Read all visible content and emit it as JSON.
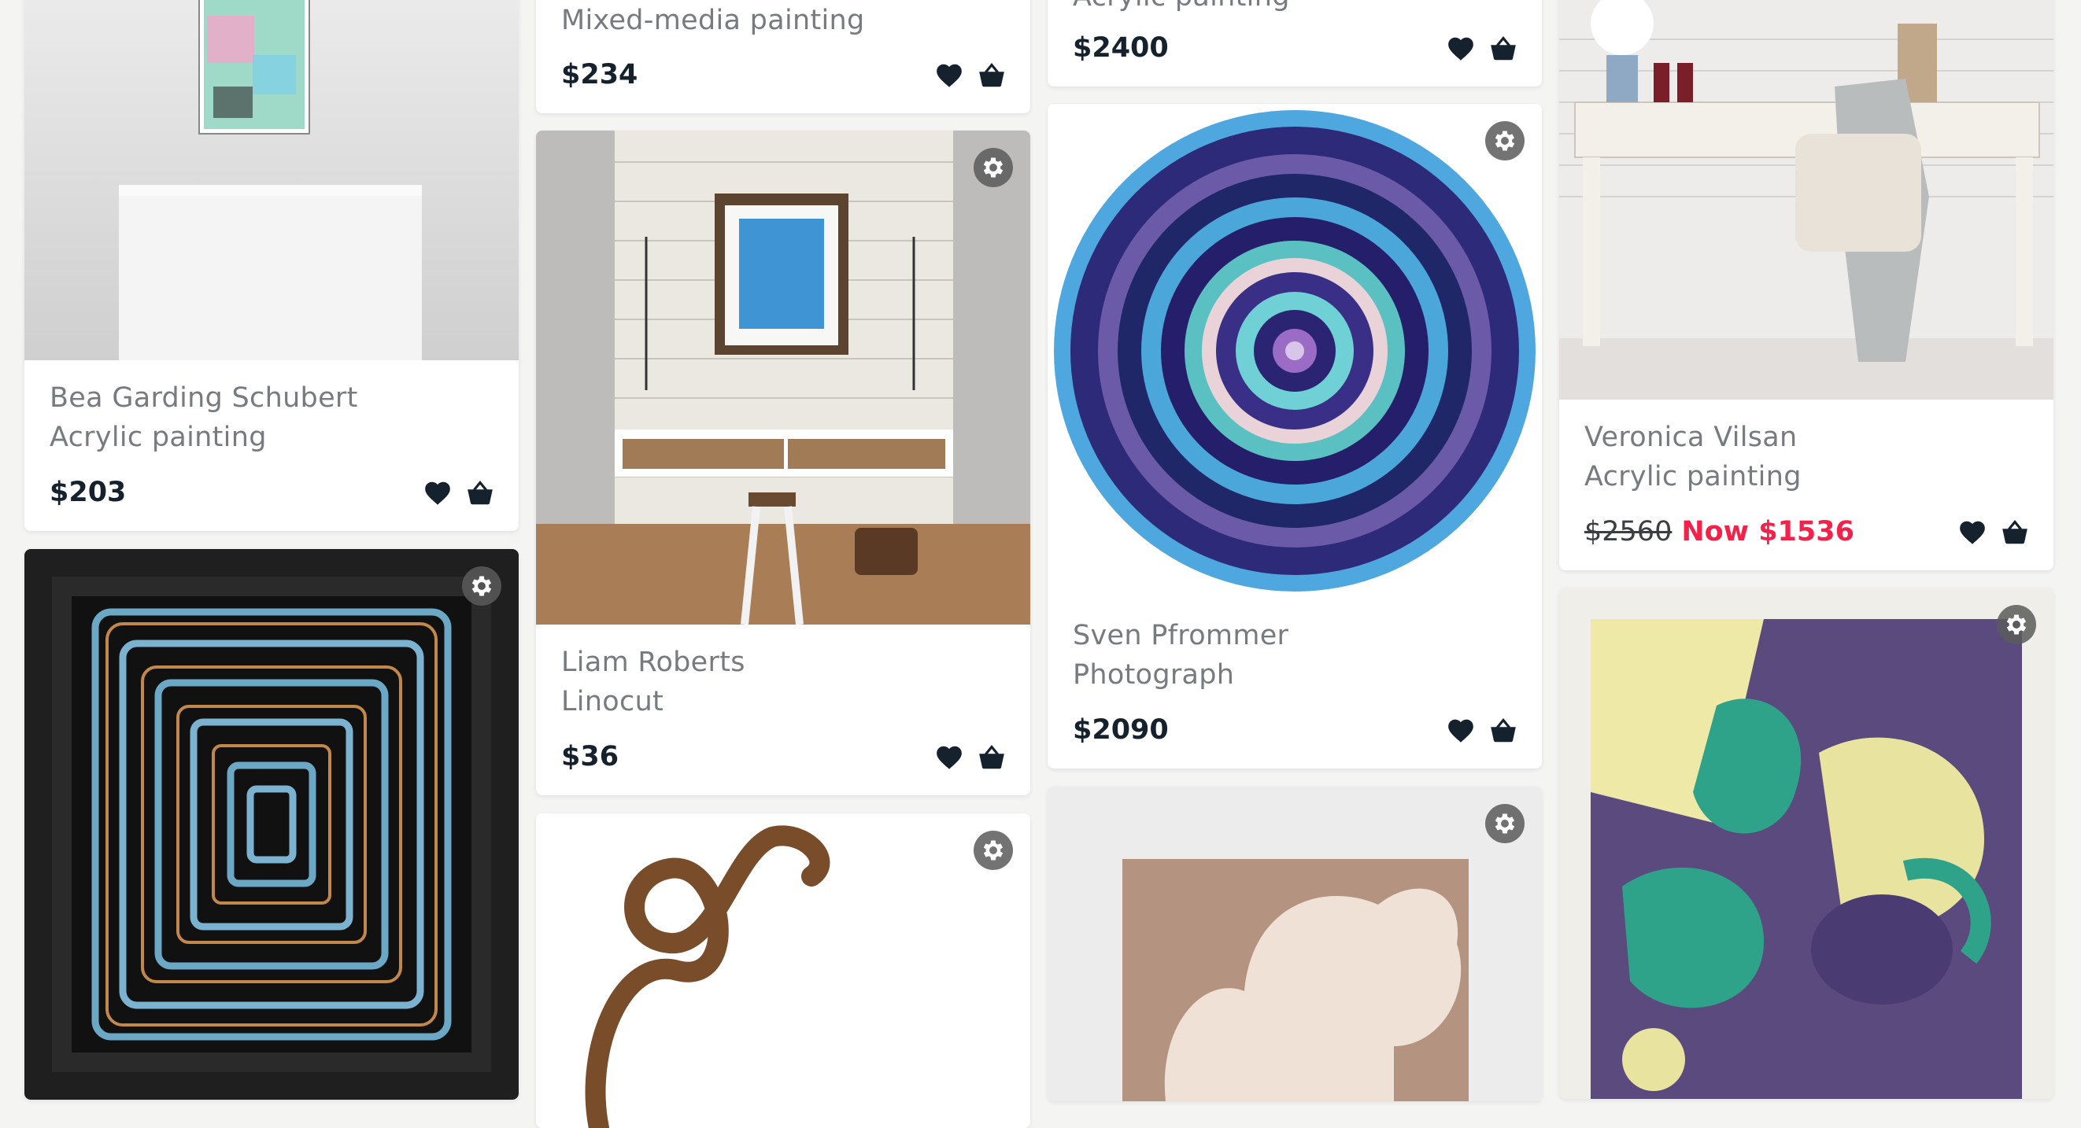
{
  "colors": {
    "background": "#f4f4f3",
    "card": "#ffffff",
    "price": "#16212e",
    "muted": "#777b80",
    "sale": "#f2224a"
  },
  "icons": {
    "favorite": "heart-icon",
    "cart": "basket-icon",
    "settings": "gear-icon"
  },
  "cards": [
    {
      "artist": "Bea Garding Schubert",
      "medium": "Acrylic painting",
      "price": "$203"
    },
    {
      "artist": "",
      "medium": "",
      "price": ""
    },
    {
      "artist": "",
      "medium": "Mixed-media painting",
      "price": "$234"
    },
    {
      "artist": "Liam Roberts",
      "medium": "Linocut",
      "price": "$36"
    },
    {
      "artist": "",
      "medium": "",
      "price": ""
    },
    {
      "artist": "",
      "medium": "Acrylic painting",
      "price": "$2400"
    },
    {
      "artist": "Sven Pfrommer",
      "medium": "Photograph",
      "price": "$2090"
    },
    {
      "artist": "",
      "medium": "",
      "price": ""
    },
    {
      "artist": "Veronica Vilsan",
      "medium": "Acrylic painting",
      "old_price": "$2560",
      "sale_price": "Now $1536"
    },
    {
      "artist": "",
      "medium": "",
      "price": ""
    }
  ]
}
